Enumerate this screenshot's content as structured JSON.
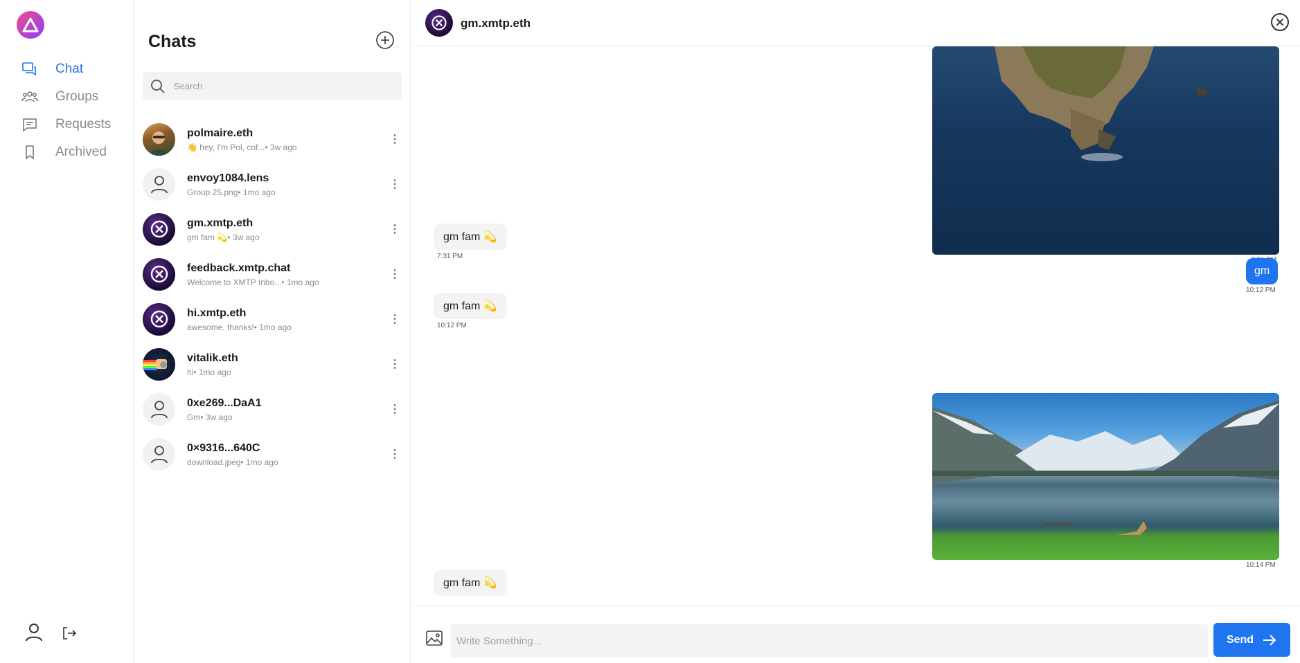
{
  "nav": {
    "items": [
      {
        "label": "Chat",
        "icon": "chat-icon",
        "active": true
      },
      {
        "label": "Groups",
        "icon": "groups-icon",
        "active": false
      },
      {
        "label": "Requests",
        "icon": "requests-icon",
        "active": false
      },
      {
        "label": "Archived",
        "icon": "bookmark-icon",
        "active": false
      }
    ],
    "accent": "#1f74ef"
  },
  "list": {
    "title": "Chats",
    "search_placeholder": "Search",
    "conversations": [
      {
        "name": "polmaire.eth",
        "preview": "👋 hey, I'm Pol, cof...• 3w ago",
        "avatar": "photo"
      },
      {
        "name": "envoy1084.lens",
        "preview": "Group 25.png• 1mo ago",
        "avatar": "person"
      },
      {
        "name": "gm.xmtp.eth",
        "preview": "gm fam 💫• 3w ago",
        "avatar": "xmtp"
      },
      {
        "name": "feedback.xmtp.chat",
        "preview": "Welcome to XMTP Inbo...• 1mo ago",
        "avatar": "xmtp"
      },
      {
        "name": "hi.xmtp.eth",
        "preview": "awesome, thanks!• 1mo ago",
        "avatar": "xmtp"
      },
      {
        "name": "vitalik.eth",
        "preview": "hi• 1mo ago",
        "avatar": "nyan"
      },
      {
        "name": "0xe269...DaA1",
        "preview": "Gm• 3w ago",
        "avatar": "person"
      },
      {
        "name": "0×9316...640C",
        "preview": "download.jpeg• 1mo ago",
        "avatar": "person"
      }
    ]
  },
  "conversation": {
    "title": "gm.xmtp.eth",
    "messages": [
      {
        "kind": "image",
        "dir": "out",
        "time": "7:31 PM"
      },
      {
        "kind": "text",
        "dir": "in",
        "text": "gm fam 💫",
        "time": "7:31 PM"
      },
      {
        "kind": "text",
        "dir": "out",
        "text": "gm",
        "time": "10:12 PM"
      },
      {
        "kind": "text",
        "dir": "in",
        "text": "gm fam 💫",
        "time": "10:12 PM"
      },
      {
        "kind": "image",
        "dir": "out",
        "time": "10:14 PM"
      },
      {
        "kind": "text",
        "dir": "in",
        "text": "gm fam 💫",
        "time": ""
      }
    ],
    "composer_placeholder": "Write Something...",
    "send_label": "Send"
  }
}
